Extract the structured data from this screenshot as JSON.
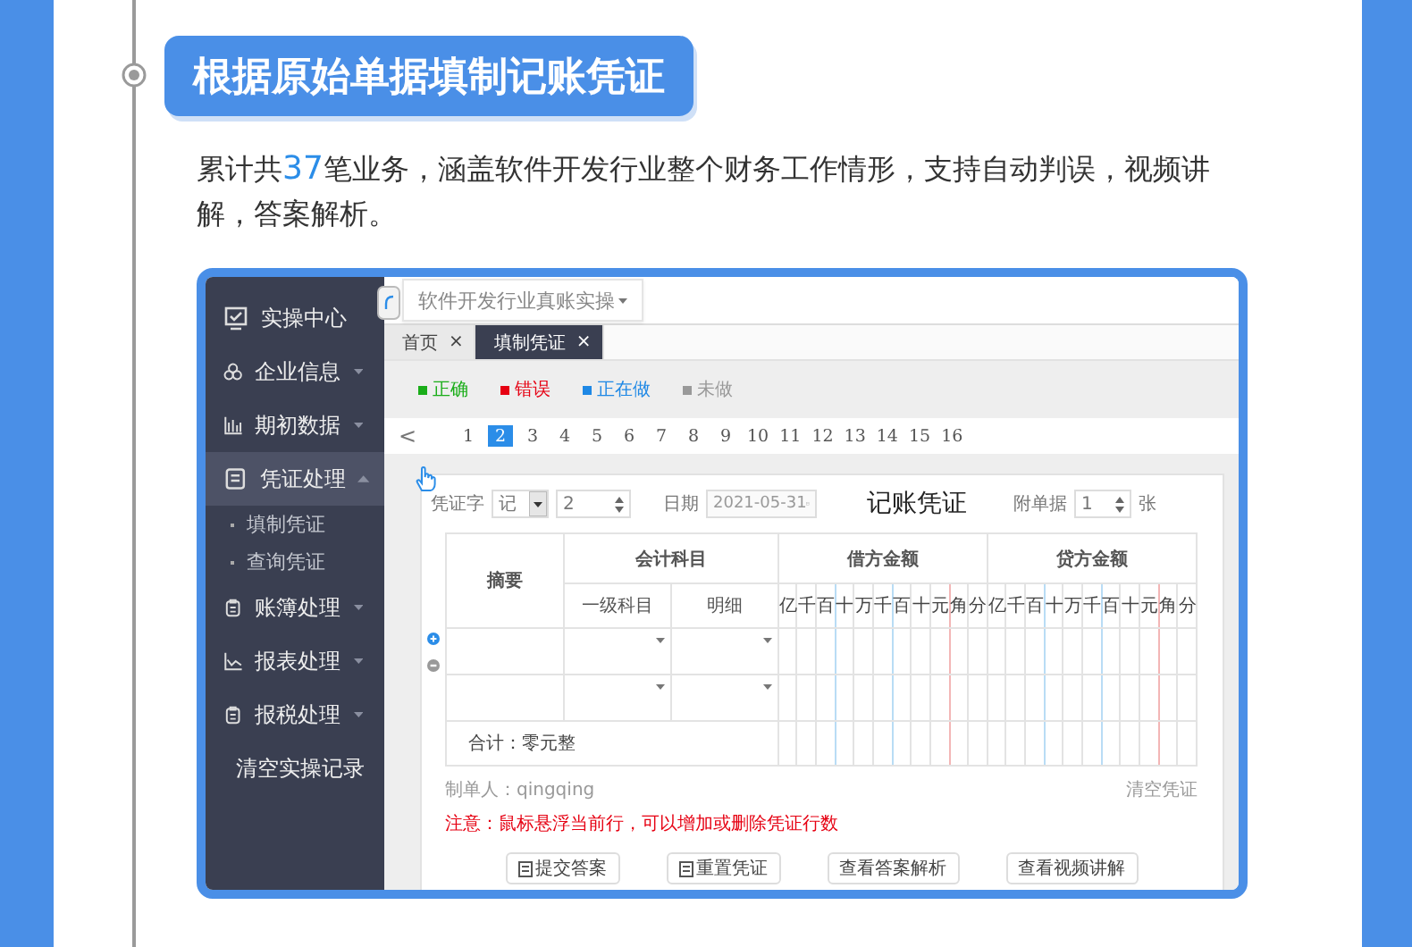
{
  "page": {
    "heading": "根据原始单据填制记账凭证",
    "intro": {
      "lead": "累计共",
      "count": "37",
      "rest": "笔业务，涵盖软件开发行业整个财务工作情形，支持自动判误，视频讲解，答案解析。"
    }
  },
  "app": {
    "sidebar": {
      "items": [
        {
          "label": "实操中心",
          "expandable": false,
          "selected": false
        },
        {
          "label": "企业信息",
          "expandable": true,
          "expanded": false,
          "selected": false
        },
        {
          "label": "期初数据",
          "expandable": true,
          "expanded": false,
          "selected": false
        },
        {
          "label": "凭证处理",
          "expandable": true,
          "expanded": true,
          "selected": true,
          "children": [
            {
              "label": "填制凭证"
            },
            {
              "label": "查询凭证"
            }
          ]
        },
        {
          "label": "账簿处理",
          "expandable": true,
          "expanded": false,
          "selected": false
        },
        {
          "label": "报表处理",
          "expandable": true,
          "expanded": false,
          "selected": false
        },
        {
          "label": "报税处理",
          "expandable": true,
          "expanded": false,
          "selected": false
        },
        {
          "label": "清空实操记录",
          "expandable": false,
          "selected": false
        }
      ]
    },
    "company_select": {
      "value": "软件开发行业真账实操"
    },
    "tabs": [
      {
        "label": "首页",
        "close": "×",
        "selected": false
      },
      {
        "label": "填制凭证",
        "close": "×",
        "selected": true
      }
    ],
    "legend": [
      {
        "label": "正确",
        "color": "#1aad19"
      },
      {
        "label": "错误",
        "color": "#e60012"
      },
      {
        "label": "正在做",
        "color": "#1e88e5"
      },
      {
        "label": "未做",
        "color": "#999999"
      }
    ],
    "pager": {
      "prev": "<",
      "pages": [
        {
          "label": "1",
          "selected": false
        },
        {
          "label": "2",
          "selected": true
        },
        {
          "label": "3",
          "selected": false
        },
        {
          "label": "4",
          "selected": false
        },
        {
          "label": "5",
          "selected": false
        },
        {
          "label": "6",
          "selected": false
        },
        {
          "label": "7",
          "selected": false
        },
        {
          "label": "8",
          "selected": false
        },
        {
          "label": "9",
          "selected": false
        },
        {
          "label": "10",
          "selected": false
        },
        {
          "label": "11",
          "selected": false
        },
        {
          "label": "12",
          "selected": false
        },
        {
          "label": "13",
          "selected": false
        },
        {
          "label": "14",
          "selected": false
        },
        {
          "label": "15",
          "selected": false
        },
        {
          "label": "16",
          "selected": false
        }
      ]
    },
    "voucher": {
      "word_label": "凭证字",
      "word": "记",
      "number": "2",
      "date_label": "日期",
      "date": "2021-05-31",
      "title": "记账凭证",
      "attach_label": "附单据",
      "attach_count": "1",
      "attach_unit": "张",
      "columns": {
        "summary": "摘要",
        "account": "会计科目",
        "account_level1": "一级科目",
        "account_detail": "明细",
        "debit": "借方金额",
        "credit": "贷方金额",
        "debit_digits": [
          "亿",
          "千",
          "百",
          "十",
          "万",
          "千",
          "百",
          "十",
          "元",
          "角",
          "分"
        ],
        "credit_digits": [
          "亿",
          "千",
          "百",
          "十",
          "万",
          "千",
          "百",
          "十",
          "元",
          "角",
          "分"
        ]
      },
      "rows": [
        {
          "kind": "entry"
        },
        {
          "kind": "entry"
        }
      ],
      "total": "合计：零元整",
      "preparer": "制单人：qingqing",
      "clear": "清空凭证",
      "note": "注意：鼠标悬浮当前行，可以增加或删除凭证行数",
      "buttons": [
        {
          "label": "提交答案",
          "kind": "icon"
        },
        {
          "label": "重置凭证",
          "kind": "icon"
        },
        {
          "label": "查看答案解析",
          "kind": "plain"
        },
        {
          "label": "查看视频讲解",
          "kind": "plain"
        }
      ]
    }
  }
}
